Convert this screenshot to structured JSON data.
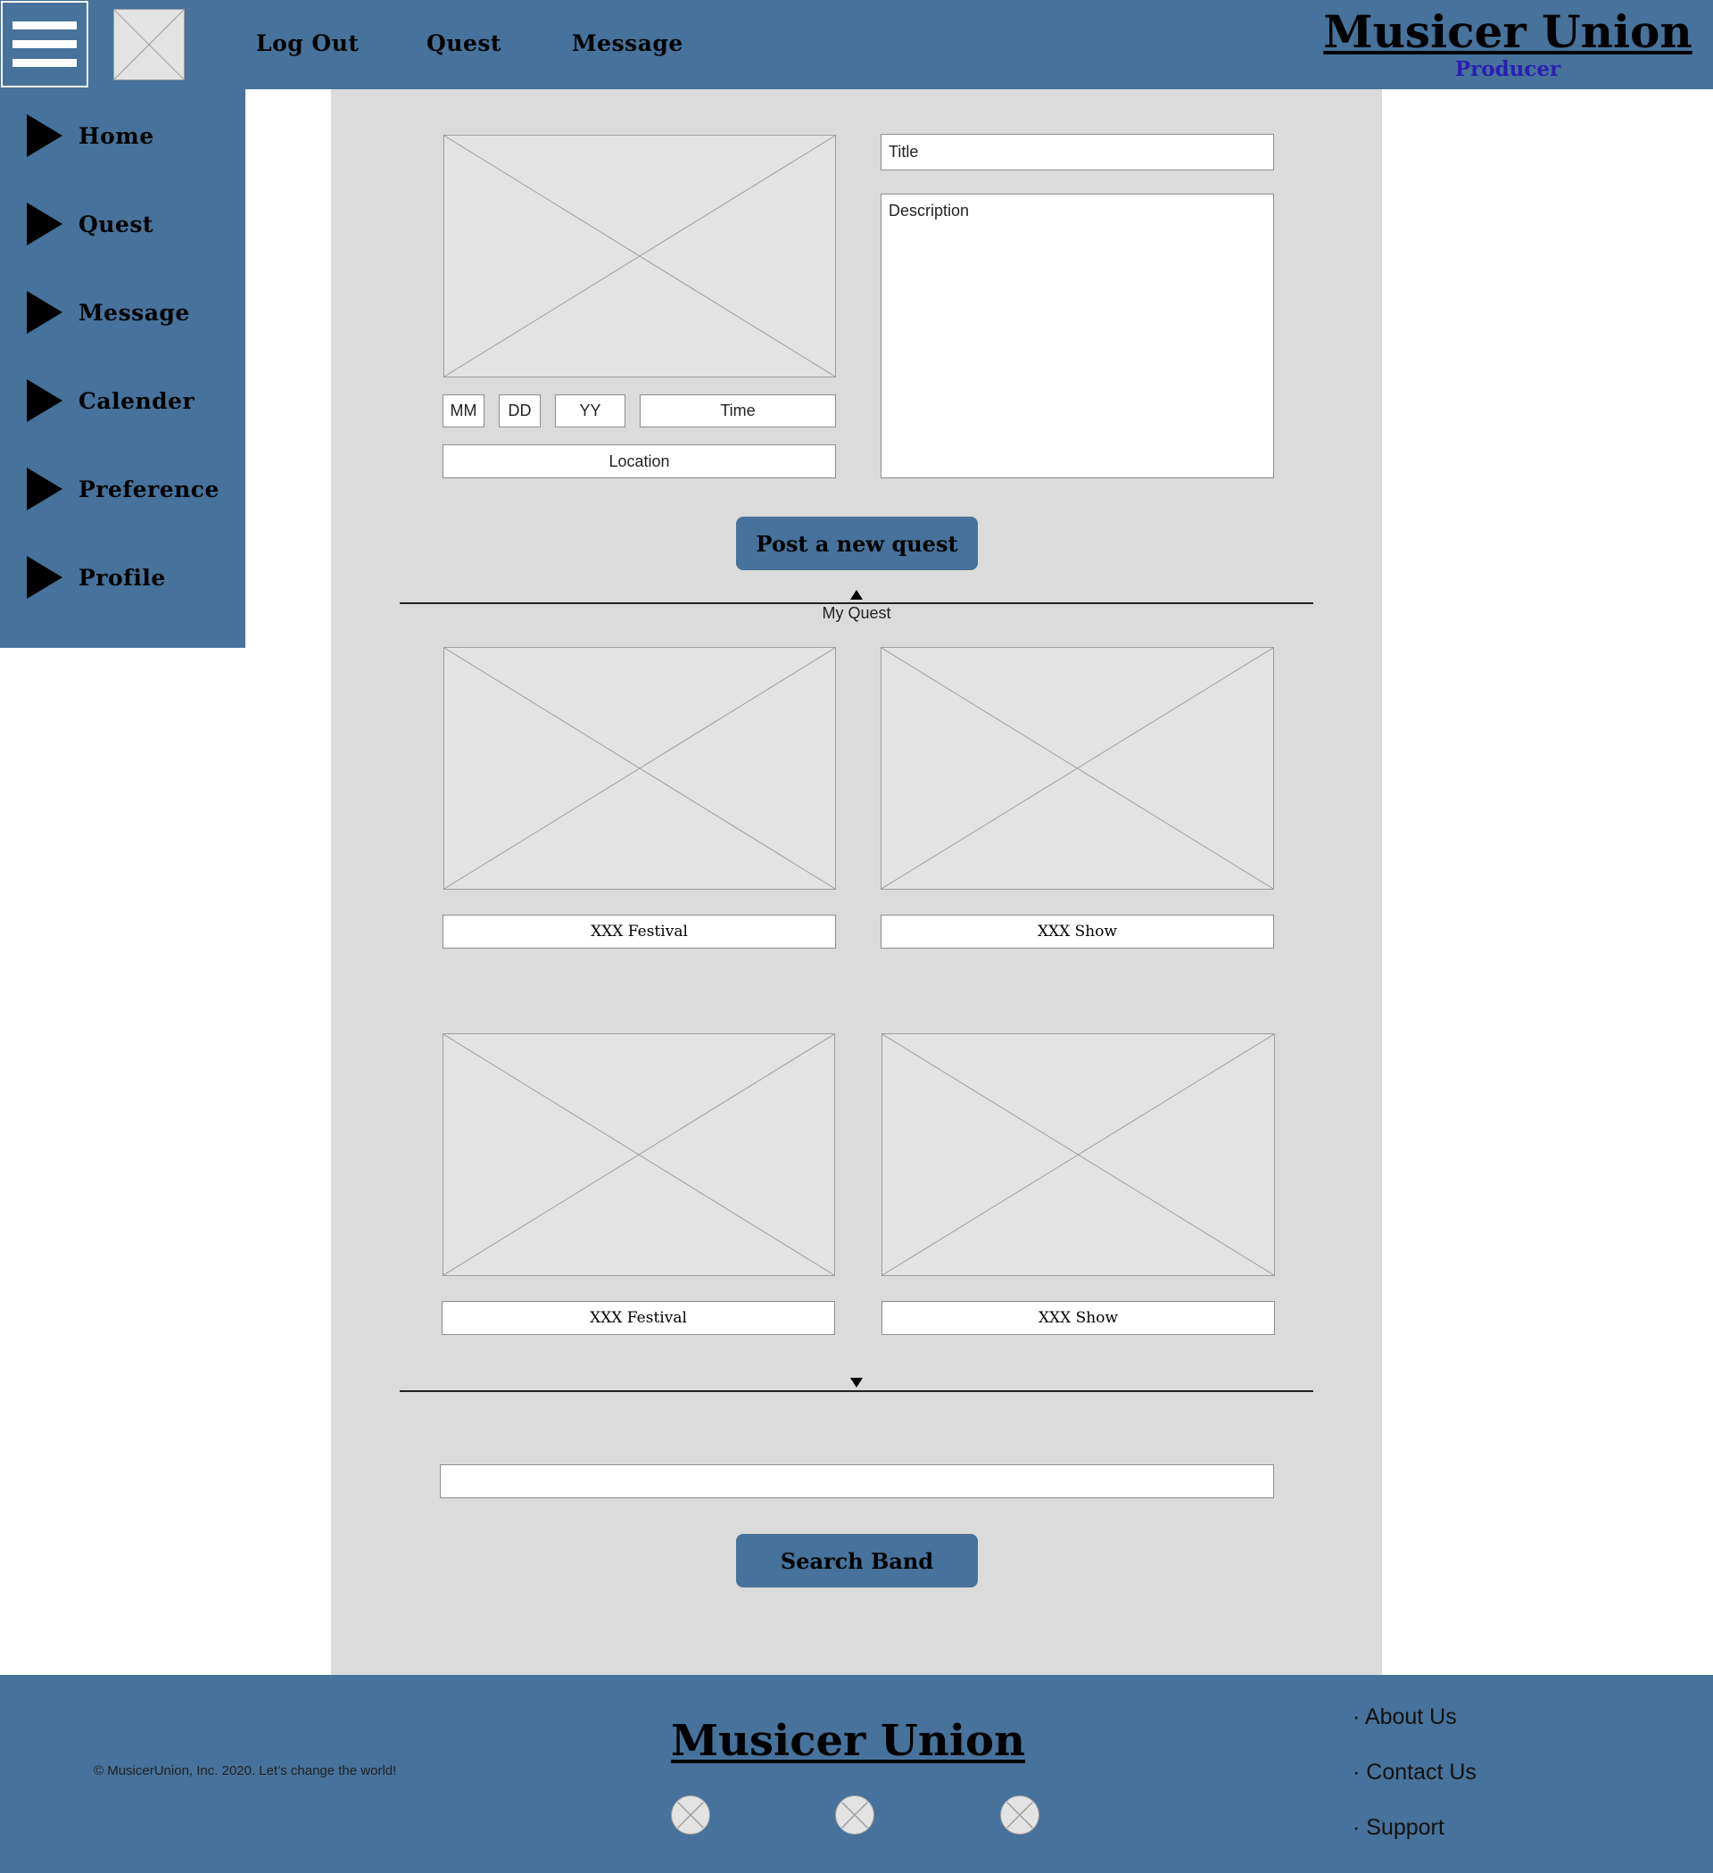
{
  "header": {
    "menu_icon": "hamburger-menu-icon",
    "logo": "image-placeholder",
    "nav": [
      "Log Out",
      "Quest",
      "Message"
    ],
    "brand_name": "Musicer Union",
    "brand_role": "Producer"
  },
  "sidebar": {
    "items": [
      {
        "label": "Home",
        "icon": "play-arrow-icon"
      },
      {
        "label": "Quest",
        "icon": "play-arrow-icon"
      },
      {
        "label": "Message",
        "icon": "play-arrow-icon"
      },
      {
        "label": "Calender",
        "icon": "play-arrow-icon"
      },
      {
        "label": "Preference",
        "icon": "play-arrow-icon"
      },
      {
        "label": "Profile",
        "icon": "play-arrow-icon"
      }
    ]
  },
  "quest_form": {
    "month_placeholder": "MM",
    "day_placeholder": "DD",
    "year_placeholder": "YY",
    "time_placeholder": "Time",
    "location_placeholder": "Location",
    "title_placeholder": "Title",
    "description_placeholder": "Description",
    "submit_label": "Post a new quest"
  },
  "my_quest": {
    "label": "My Quest",
    "cards": [
      {
        "caption": "XXX Festival"
      },
      {
        "caption": "XXX Show"
      },
      {
        "caption": "XXX Festival"
      },
      {
        "caption": "XXX Show"
      }
    ]
  },
  "search": {
    "input_value": "",
    "button_label": "Search Band"
  },
  "footer": {
    "copyright": "© MusicerUnion, Inc. 2020. Let’s change the world!",
    "brand_name": "Musicer Union",
    "links": [
      "· About Us",
      "· Contact Us",
      "· Support"
    ],
    "social_icons": [
      "social-icon-placeholder",
      "social-icon-placeholder",
      "social-icon-placeholder"
    ]
  },
  "colors": {
    "brand_blue": "#46729b",
    "panel_gray": "#dbdbdb",
    "role_text": "#2a1fb0"
  }
}
